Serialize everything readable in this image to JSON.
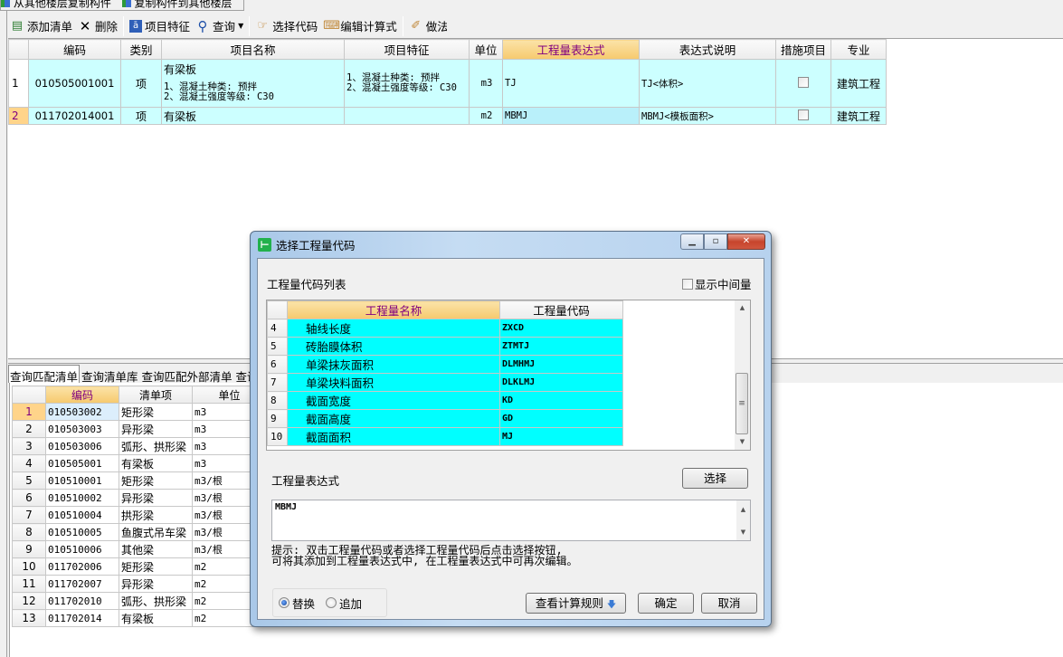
{
  "top_tabs": [
    "从其他楼层复制构件",
    "复制构件到其他楼层"
  ],
  "toolbar": {
    "add_list": "添加清单",
    "delete": "删除",
    "item_features": "项目特征",
    "query": "查询",
    "select_code": "选择代码",
    "edit_formula": "编辑计算式",
    "do_method": "做法"
  },
  "upper_grid": {
    "headers": [
      "编码",
      "类别",
      "项目名称",
      "项目特征",
      "单位",
      "工程量表达式",
      "表达式说明",
      "措施项目",
      "专业"
    ],
    "rows": [
      {
        "num": "1",
        "code": "010505001001",
        "type": "项",
        "name": "有梁板",
        "name_features": "1、混凝土种类: 预拌\n2、混凝土强度等级: C30",
        "features": "1、混凝土种类: 预拌\n2、混凝土强度等级: C30",
        "unit": "m3",
        "expr": "TJ",
        "expr_desc": "TJ<体积>",
        "measure": false,
        "specialty": "建筑工程"
      },
      {
        "num": "2",
        "code": "011702014001",
        "type": "项",
        "name": "有梁板",
        "name_features": "",
        "features": "",
        "unit": "m2",
        "expr": "MBMJ",
        "expr_desc": "MBMJ<模板面积>",
        "measure": false,
        "specialty": "建筑工程"
      }
    ]
  },
  "lower_tabs": [
    "查询匹配清单",
    "查询清单库",
    "查询匹配外部清单",
    "查询"
  ],
  "lower_grid": {
    "headers": [
      "编码",
      "清单项",
      "单位"
    ],
    "rows": [
      [
        "1",
        "010503002",
        "矩形梁",
        "m3"
      ],
      [
        "2",
        "010503003",
        "异形梁",
        "m3"
      ],
      [
        "3",
        "010503006",
        "弧形、拱形梁",
        "m3"
      ],
      [
        "4",
        "010505001",
        "有梁板",
        "m3"
      ],
      [
        "5",
        "010510001",
        "矩形梁",
        "m3/根"
      ],
      [
        "6",
        "010510002",
        "异形梁",
        "m3/根"
      ],
      [
        "7",
        "010510004",
        "拱形梁",
        "m3/根"
      ],
      [
        "8",
        "010510005",
        "鱼腹式吊车梁",
        "m3/根"
      ],
      [
        "9",
        "010510006",
        "其他梁",
        "m3/根"
      ],
      [
        "10",
        "011702006",
        "矩形梁",
        "m2"
      ],
      [
        "11",
        "011702007",
        "异形梁",
        "m2"
      ],
      [
        "12",
        "011702010",
        "弧形、拱形梁",
        "m2"
      ],
      [
        "13",
        "011702014",
        "有梁板",
        "m2"
      ]
    ]
  },
  "dialog": {
    "title": "选择工程量代码",
    "list_label": "工程量代码列表",
    "show_intermediate": "显示中间量",
    "show_intermediate_checked": false,
    "code_headers": [
      "工程量名称",
      "工程量代码"
    ],
    "codes": [
      [
        "4",
        "轴线长度",
        "ZXCD"
      ],
      [
        "5",
        "砖胎膜体积",
        "ZTMTJ"
      ],
      [
        "6",
        "单梁抹灰面积",
        "DLMHMJ"
      ],
      [
        "7",
        "单梁块料面积",
        "DLKLMJ"
      ],
      [
        "8",
        "截面宽度",
        "KD"
      ],
      [
        "9",
        "截面高度",
        "GD"
      ],
      [
        "10",
        "截面面积",
        "MJ"
      ]
    ],
    "expr_label": "工程量表达式",
    "select_button": "选择",
    "expr_value": "MBMJ",
    "hint_line1": "提示: 双击工程量代码或者选择工程量代码后点击选择按钮,",
    "hint_line2": "可将其添加到工程量表达式中, 在工程量表达式中可再次编辑。",
    "radio_replace": "替换",
    "radio_append": "追加",
    "radio_selected": "替换",
    "view_rules_button": "查看计算规则",
    "ok_button": "确定",
    "cancel_button": "取消"
  }
}
